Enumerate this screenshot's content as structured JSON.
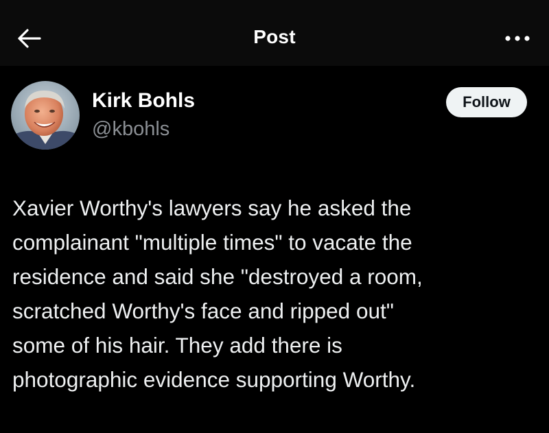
{
  "header": {
    "title": "Post",
    "back_icon": "arrow-left-icon",
    "more_icon": "more-horizontal-icon"
  },
  "author": {
    "name": "Kirk Bohls",
    "handle": "@kbohls",
    "follow_label": "Follow"
  },
  "post": {
    "text": "Xavier Worthy's lawyers say he asked the\ncomplainant \"multiple times\" to vacate the\nresidence and said she \"destroyed a room,\nscratched Worthy's face and ripped out\"\nsome of his hair. They add there is\nphotographic evidence supporting Worthy."
  },
  "colors": {
    "background": "#000000",
    "header_background": "#0b0b0b",
    "primary_text": "#e7e9ea",
    "secondary_text": "#8b8f94",
    "follow_button_bg": "#eff3f4",
    "follow_button_text": "#0f1419"
  }
}
